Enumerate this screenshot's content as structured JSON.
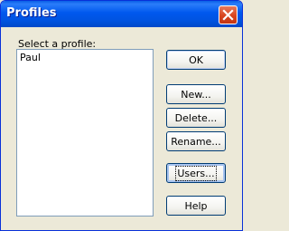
{
  "window": {
    "title": "Profiles"
  },
  "profiles": {
    "prompt": "Select a profile:",
    "items": [
      "Paul"
    ]
  },
  "buttons": {
    "ok": "OK",
    "new": "New...",
    "delete": "Delete...",
    "rename": "Rename...",
    "users": "Users...",
    "help": "Help"
  },
  "icons": {
    "close": "close-icon"
  },
  "colors": {
    "titlebar": "#0058ee",
    "close_button": "#d8451e",
    "dialog_background": "#ece9d8"
  }
}
